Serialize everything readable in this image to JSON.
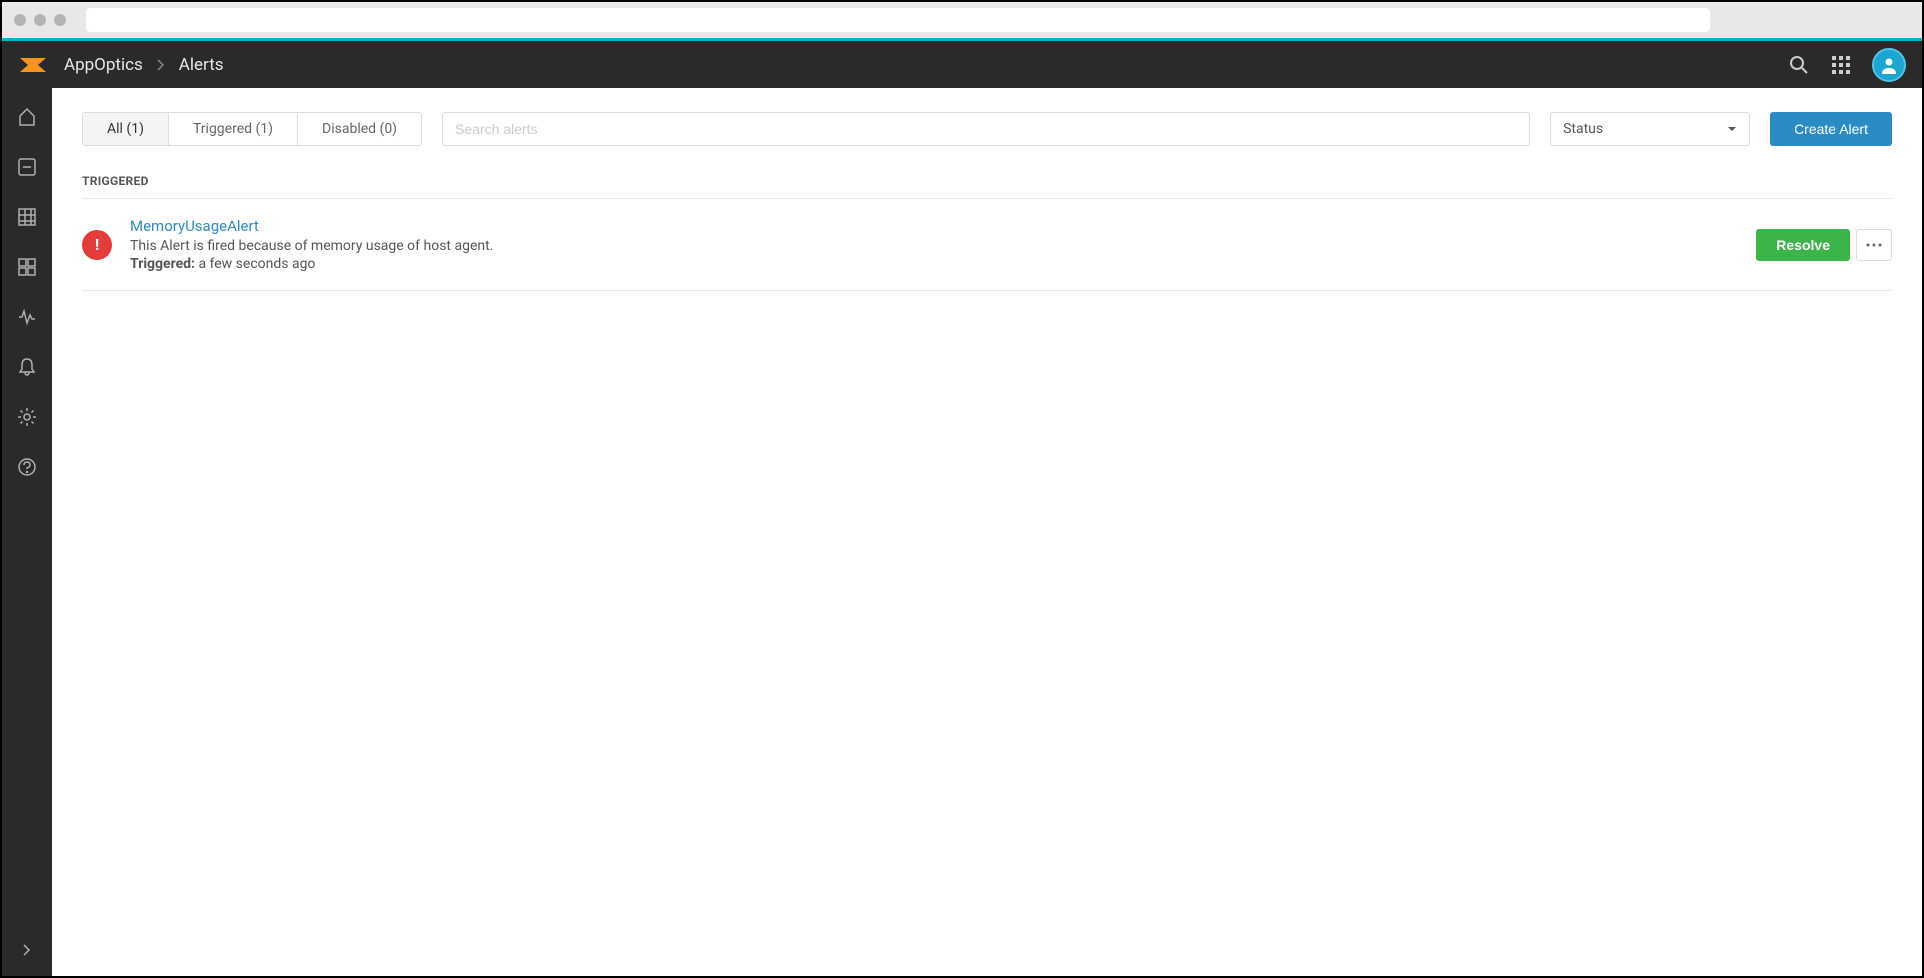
{
  "breadcrumb": {
    "app": "AppOptics",
    "page": "Alerts"
  },
  "tabs": {
    "all": "All (1)",
    "triggered": "Triggered (1)",
    "disabled": "Disabled (0)"
  },
  "search": {
    "placeholder": "Search alerts"
  },
  "filter": {
    "status_label": "Status"
  },
  "buttons": {
    "create": "Create Alert",
    "resolve": "Resolve"
  },
  "section": {
    "triggered_label": "TRIGGERED"
  },
  "alerts": [
    {
      "badge": "!",
      "name": "MemoryUsageAlert",
      "description": "This Alert is fired because of memory usage of host agent.",
      "triggered_label": "Triggered:",
      "triggered_value": " a few seconds ago"
    }
  ]
}
